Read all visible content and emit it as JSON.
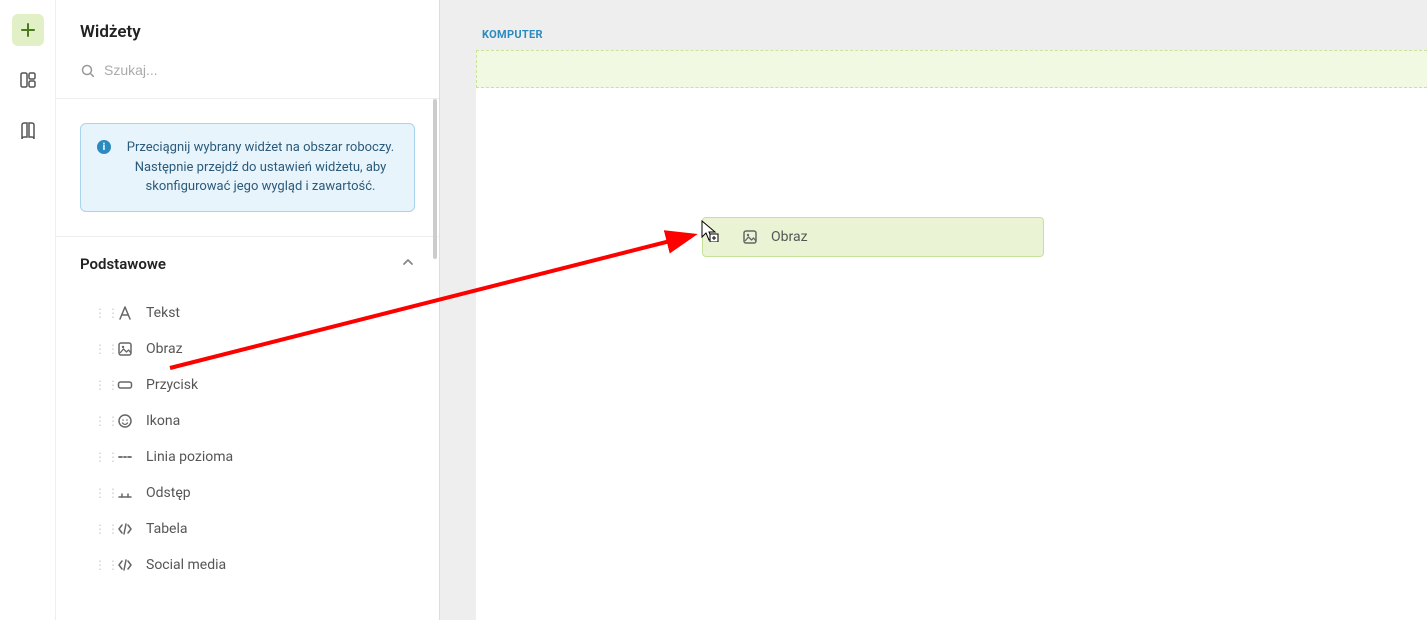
{
  "sidebar": {
    "title": "Widżety",
    "search_placeholder": "Szukaj...",
    "help_text": "Przeciągnij wybrany widżet na obszar roboczy. Następnie przejdź do ustawień widżetu, aby skonfigurować jego wygląd i zawartość.",
    "group_label": "Podstawowe",
    "widgets": [
      {
        "name": "Tekst",
        "icon": "font-icon"
      },
      {
        "name": "Obraz",
        "icon": "image-icon"
      },
      {
        "name": "Przycisk",
        "icon": "button-icon"
      },
      {
        "name": "Ikona",
        "icon": "smiley-icon"
      },
      {
        "name": "Linia pozioma",
        "icon": "hr-icon"
      },
      {
        "name": "Odstęp",
        "icon": "spacer-icon"
      },
      {
        "name": "Tabela",
        "icon": "code-icon"
      },
      {
        "name": "Social media",
        "icon": "code-icon"
      }
    ]
  },
  "canvas": {
    "tab_label": "KOMPUTER"
  },
  "drag_ghost": {
    "label": "Obraz",
    "icon": "image-icon"
  },
  "colors": {
    "accent_green_bg": "#e2f0c7",
    "accent_blue": "#2b8abf",
    "help_bg": "#e8f4fb",
    "dropzone_bg": "#f2f9e2",
    "annotation_red": "#ff0000"
  }
}
